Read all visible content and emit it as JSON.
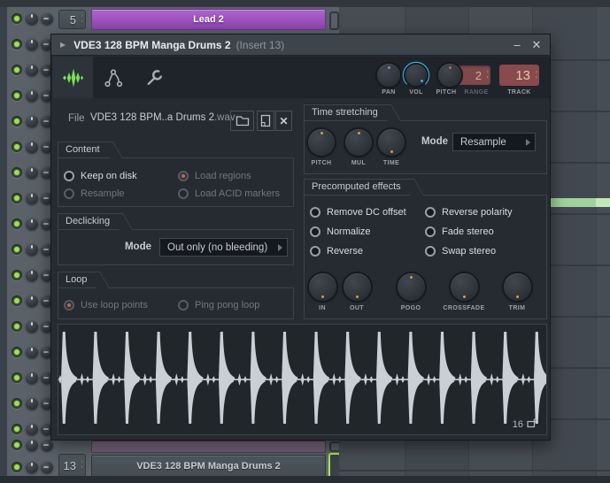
{
  "window": {
    "arrow": "▶",
    "title": "VDE3 128 BPM Manga Drums 2",
    "subtitle": "(Insert 13)",
    "minimize": "–",
    "close": "✕"
  },
  "toolbar": {
    "tabs": [
      {
        "name": "sample-properties",
        "active": true
      },
      {
        "name": "envelope",
        "active": false
      },
      {
        "name": "miscellaneous",
        "active": false
      }
    ],
    "pan_label": "PAN",
    "vol_label": "VOL",
    "pitch_label": "PITCH",
    "range_label": "RANGE",
    "range_value": "2",
    "track_label": "TRACK",
    "track_value": "13"
  },
  "file": {
    "label": "File",
    "name": "VDE3 128 BPM..a Drums 2",
    "ext": ".wav"
  },
  "content": {
    "title": "Content",
    "options": [
      {
        "label": "Keep on disk",
        "selected": false,
        "enabled": true
      },
      {
        "label": "Load regions",
        "selected": true,
        "enabled": false
      },
      {
        "label": "Resample",
        "selected": false,
        "enabled": false
      },
      {
        "label": "Load ACID markers",
        "selected": false,
        "enabled": false
      }
    ]
  },
  "declicking": {
    "title": "Declicking",
    "mode_label": "Mode",
    "mode_value": "Out only (no bleeding)"
  },
  "loop": {
    "title": "Loop",
    "options": [
      {
        "label": "Use loop points",
        "selected": true,
        "enabled": false
      },
      {
        "label": "Ping pong loop",
        "selected": false,
        "enabled": false
      }
    ]
  },
  "time_stretching": {
    "title": "Time stretching",
    "knobs": [
      {
        "label": "PITCH",
        "dot": "top"
      },
      {
        "label": "MUL",
        "dot": "top"
      },
      {
        "label": "TIME",
        "dot": "bottom"
      }
    ],
    "mode_label": "Mode",
    "mode_value": "Resample"
  },
  "precomputed": {
    "title": "Precomputed effects",
    "options": [
      {
        "label": "Remove DC offset",
        "selected": false,
        "enabled": true
      },
      {
        "label": "Reverse polarity",
        "selected": false,
        "enabled": true
      },
      {
        "label": "Normalize",
        "selected": false,
        "enabled": true
      },
      {
        "label": "Fade stereo",
        "selected": false,
        "enabled": true
      },
      {
        "label": "Reverse",
        "selected": false,
        "enabled": true
      },
      {
        "label": "Swap stereo",
        "selected": false,
        "enabled": true
      }
    ],
    "knobs": [
      {
        "label": "IN",
        "dot": "bottom"
      },
      {
        "label": "OUT",
        "dot": "bottom"
      },
      {
        "label": "POGO",
        "dot": "top"
      },
      {
        "label": "CROSSFADE",
        "dot": "bottom"
      },
      {
        "label": "TRIM",
        "dot": "bottom"
      }
    ]
  },
  "waveform": {
    "hits": 16,
    "count": "16"
  },
  "rack": {
    "side_rows": 17,
    "top_channel": {
      "number": "5",
      "name": "Lead 2"
    },
    "bottom_channel": {
      "number": "13",
      "name": "VDE3 128 BPM Manga Drums 2"
    }
  },
  "colors": {
    "accent_green": "#79E453",
    "vol_arc": "#3FA8E0",
    "knob_dot": "#D9994C",
    "value_box_red": "#7E484D",
    "value_text": "#DCAF84",
    "led_green": "#98E44B",
    "clip_green": "#9FD39D",
    "channel_purple": "#A05BC4",
    "selected_radio": "#B5664F"
  }
}
